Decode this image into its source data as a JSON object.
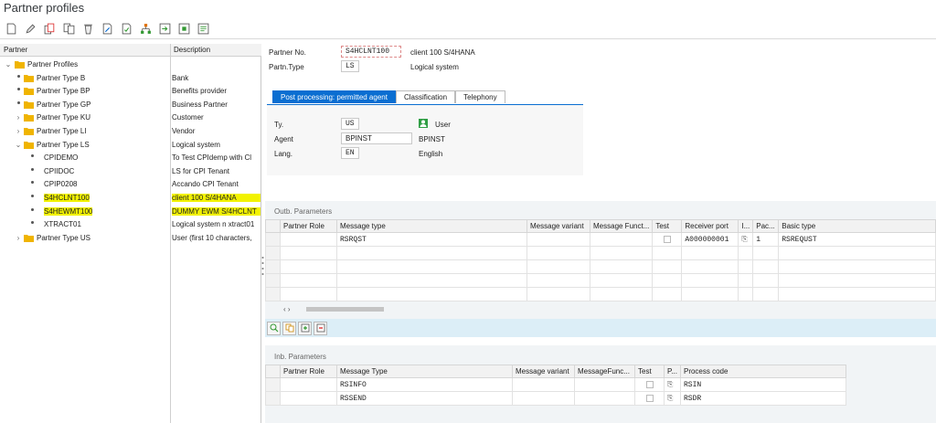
{
  "window": {
    "title": "Partner profiles"
  },
  "toolbar": {
    "buttons": [
      "new-icon",
      "edit-icon",
      "copy-icon",
      "duplicate-icon",
      "delete-icon",
      "edit-doc-icon",
      "check-icon",
      "hierarchy-icon",
      "export-icon",
      "import-icon",
      "print-icon"
    ]
  },
  "tree": {
    "col_partner": "Partner",
    "col_description": "Description",
    "root": "Partner Profiles",
    "nodes": [
      {
        "label": "Partner Type B",
        "desc": "Bank"
      },
      {
        "label": "Partner Type BP",
        "desc": "Benefits provider"
      },
      {
        "label": "Partner Type GP",
        "desc": "Business Partner"
      },
      {
        "label": "Partner Type KU",
        "desc": "Customer"
      },
      {
        "label": "Partner Type LI",
        "desc": "Vendor"
      },
      {
        "label": "Partner Type LS",
        "desc": "Logical system"
      },
      {
        "label": "CPIDEMO",
        "desc": "To Test CPIdemp with Cl"
      },
      {
        "label": "CPIIDOC",
        "desc": "LS for CPI Tenant"
      },
      {
        "label": "CPIP0208",
        "desc": "Accando CPI Tenant"
      },
      {
        "label": "S4HCLNT100",
        "desc": "client 100 S/4HANA"
      },
      {
        "label": "S4HEWMT100",
        "desc": "DUMMY EWM S/4HCLNT"
      },
      {
        "label": "XTRACT01",
        "desc": "Logical system n xtract01"
      },
      {
        "label": "Partner Type US",
        "desc": "User (first 10 characters,"
      }
    ]
  },
  "header": {
    "partner_no_label": "Partner No.",
    "partner_no": "S4HCLNT100",
    "partner_no_desc": "client 100 S/4HANA",
    "partn_type_label": "Partn.Type",
    "partn_type": "LS",
    "partn_type_desc": "Logical system"
  },
  "tabs": [
    "Post processing: permitted agent",
    "Classification",
    "Telephony"
  ],
  "agent": {
    "ty_label": "Ty.",
    "ty": "US",
    "ty_desc": "User",
    "agent_label": "Agent",
    "agent": "BPINST",
    "agent_desc": "BPINST",
    "lang_label": "Lang.",
    "lang": "EN",
    "lang_desc": "English"
  },
  "outb": {
    "title": "Outb. Parameters",
    "headers": [
      "Partner Role",
      "Message type",
      "Message variant",
      "Message Funct...",
      "Test",
      "Receiver port",
      "I...",
      "Pac...",
      "Basic type"
    ],
    "rows": [
      {
        "role": "",
        "msgtype": "RSRQST",
        "variant": "",
        "func": "",
        "port": "A000000001",
        "pack": "1",
        "basic": "RSREQUST"
      }
    ]
  },
  "inb": {
    "title": "Inb. Parameters",
    "headers": [
      "Partner Role",
      "Message Type",
      "Message variant",
      "MessageFunc...",
      "Test",
      "P...",
      "Process code"
    ],
    "rows": [
      {
        "role": "",
        "msgtype": "RSINFO",
        "variant": "",
        "func": "",
        "code": "RSIN"
      },
      {
        "role": "",
        "msgtype": "RSSEND",
        "variant": "",
        "func": "",
        "code": "RSDR"
      }
    ]
  },
  "colors": {
    "accent": "#0a6ed1",
    "highlight": "#f2f200",
    "folder": "#f0b400"
  }
}
